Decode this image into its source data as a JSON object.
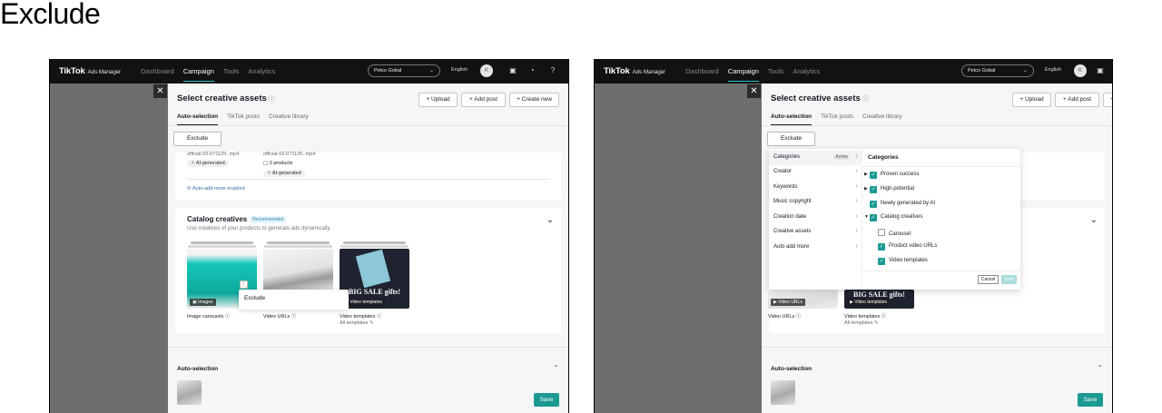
{
  "heading": "Exclude",
  "nav": {
    "logo": "TikTok",
    "logo_sub": "Ads Manager",
    "links": [
      "Dashboard",
      "Campaign",
      "Tools",
      "Analytics"
    ],
    "account": "Petco Gobal",
    "language": "English",
    "avatar_letter": "K"
  },
  "panel": {
    "title": "Select creative assets",
    "buttons": {
      "upload": "+ Upload",
      "add_post": "+ Add post",
      "create_new": "+ Create new"
    },
    "tabs": [
      "Auto-selection",
      "TikTok posts",
      "Creative library"
    ],
    "exclude_button": "Exclude"
  },
  "top_card": {
    "file1": "official-02-071125-.mp4",
    "file2": "official-02-071125-.mp4",
    "ai_tag": "AI-generated",
    "products": "3 products",
    "auto_add": "Auto-add-more enabled"
  },
  "catalog": {
    "title": "Catalog creatives",
    "badge": "Recommended",
    "subtitle": "Use creatives of your products to generate ads dynamically.",
    "items": [
      {
        "tag": "Images",
        "caption": "Image carousels"
      },
      {
        "tag": "Video URLs",
        "caption": "Video URLs"
      },
      {
        "tag": "Video templates",
        "caption": "Video templates",
        "sub": "All templates"
      }
    ],
    "sale_text": "BIG SALE gifts!"
  },
  "context_menu": {
    "item": "Exclude"
  },
  "bottom": {
    "title": "Auto-selection",
    "save": "Save"
  },
  "dropdown": {
    "left_items": [
      "Categories",
      "Creator",
      "Keywords",
      "Music copyright",
      "Creation date",
      "Creative assets",
      "Auto add more"
    ],
    "active_badge": "Active",
    "right_title": "Categories",
    "options": [
      {
        "label": "Proven success",
        "checked": true,
        "expand": true,
        "indent": 0
      },
      {
        "label": "High-potential",
        "checked": true,
        "expand": true,
        "indent": 0
      },
      {
        "label": "Newly generated by AI",
        "checked": true,
        "expand": false,
        "indent": 0
      },
      {
        "label": "Catalog creatives",
        "checked": true,
        "expand": true,
        "indent": 0
      },
      {
        "label": "Carousel",
        "checked": false,
        "expand": false,
        "indent": 1
      },
      {
        "label": "Product video URLs",
        "checked": true,
        "expand": false,
        "indent": 1
      },
      {
        "label": "Video templates",
        "checked": true,
        "expand": false,
        "indent": 1
      }
    ],
    "cancel": "Cancel",
    "save": "Save"
  },
  "colors": {
    "accent": "#1b9a92",
    "nav_bg": "#121212"
  }
}
